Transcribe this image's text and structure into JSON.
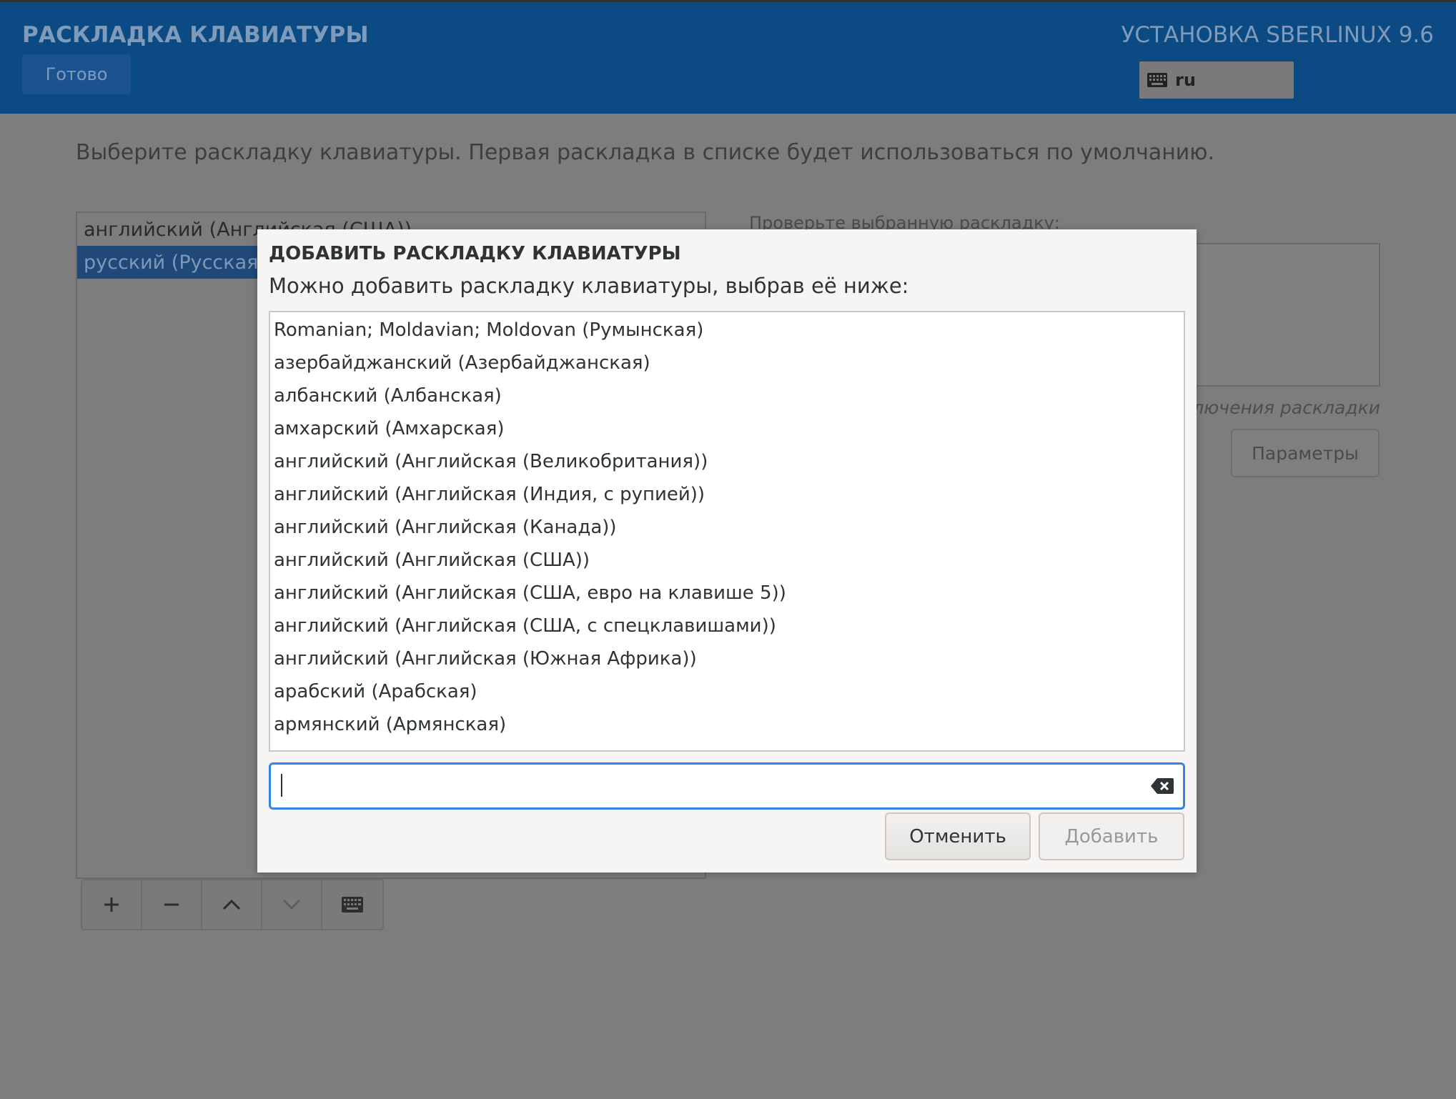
{
  "header": {
    "title": "РАСКЛАДКА КЛАВИАТУРЫ",
    "done_label": "Готово",
    "product": "УСТАНОВКА SBERLINUX 9.6",
    "keyboard_indicator": {
      "icon": "keyboard-icon",
      "label": "ru"
    }
  },
  "main": {
    "instruction": "Выберите раскладку клавиатуры. Первая раскладка в списке будет использоваться по умолчанию.",
    "layouts": [
      {
        "label": "английский (Английская (США))",
        "selected": false
      },
      {
        "label": "русский (Русская)",
        "selected": true
      }
    ],
    "toolbar": [
      {
        "name": "add-layout-button",
        "glyph": "+",
        "enabled": true
      },
      {
        "name": "remove-layout-button",
        "glyph": "−",
        "enabled": true
      },
      {
        "name": "move-up-button",
        "icon": "chevron-up-icon",
        "enabled": true
      },
      {
        "name": "move-down-button",
        "icon": "chevron-down-icon",
        "enabled": false
      },
      {
        "name": "preview-layout-button",
        "icon": "keyboard-icon",
        "enabled": true
      }
    ],
    "test_label": "Проверьте выбранную раскладку:",
    "switch_hint": "ключения раскладки.",
    "options_label": "Параметры"
  },
  "dialog": {
    "title": "ДОБАВИТЬ РАСКЛАДКУ КЛАВИАТУРЫ",
    "subtitle": "Можно добавить раскладку клавиатуры, выбрав её ниже:",
    "items": [
      "Romanian; Moldavian; Moldovan (Румынская)",
      "азербайджанский (Азербайджанская)",
      "албанский (Албанская)",
      "амхарский (Амхарская)",
      "английский (Английская (Великобритания))",
      "английский (Английская (Индия, с рупией))",
      "английский (Английская (Канада))",
      "английский (Английская (США))",
      "английский (Английская (США, евро на клавише 5))",
      "английский (Английская (США, с спецклавишами))",
      "английский (Английская (Южная Африка))",
      "арабский (Арабская)",
      "армянский (Армянская)"
    ],
    "search": {
      "value": "",
      "clear_icon": "clear-text-icon"
    },
    "cancel_label": "Отменить",
    "add_label": "Добавить"
  },
  "colors": {
    "header_bg": "#0c4a84",
    "dim_overlay_bg": "#7d7d7d",
    "focus_accent": "#3584e4",
    "selection_bg": "#20497a"
  }
}
